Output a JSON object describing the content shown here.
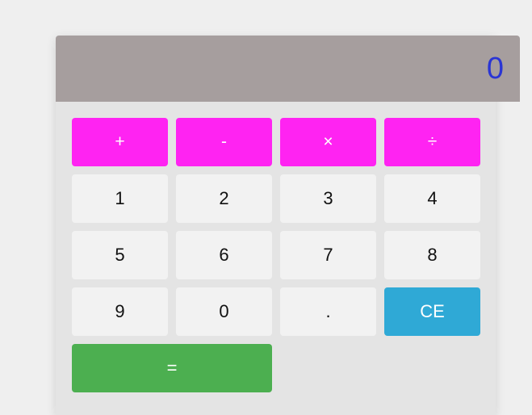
{
  "display": {
    "value": "0"
  },
  "operators": [
    "+",
    "-",
    "×",
    "÷"
  ],
  "digits_row1": [
    "1",
    "2",
    "3",
    "4"
  ],
  "digits_row2": [
    "5",
    "6",
    "7",
    "8"
  ],
  "row3": {
    "nine": "9",
    "zero": "0",
    "decimal": ".",
    "clear": "CE"
  },
  "equals": "=",
  "colors": {
    "display_bg": "#a69e9e",
    "display_text": "#2a35d4",
    "operator": "#ff23f2",
    "clear": "#2fa9d6",
    "equals": "#4caf50",
    "key": "#f2f2f2"
  }
}
